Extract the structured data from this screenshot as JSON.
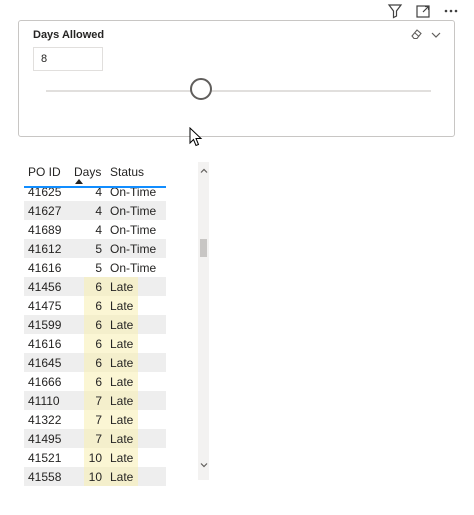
{
  "slicer": {
    "title": "Days Allowed",
    "value": "8",
    "slider_value": 8
  },
  "table": {
    "columns": [
      "PO ID",
      "Days",
      "Status"
    ],
    "sorted_column": "Days",
    "rows": [
      {
        "po_id": "41625",
        "days": "4",
        "status": "On-Time"
      },
      {
        "po_id": "41627",
        "days": "4",
        "status": "On-Time"
      },
      {
        "po_id": "41689",
        "days": "4",
        "status": "On-Time"
      },
      {
        "po_id": "41612",
        "days": "5",
        "status": "On-Time"
      },
      {
        "po_id": "41616",
        "days": "5",
        "status": "On-Time"
      },
      {
        "po_id": "41456",
        "days": "6",
        "status": "Late"
      },
      {
        "po_id": "41475",
        "days": "6",
        "status": "Late"
      },
      {
        "po_id": "41599",
        "days": "6",
        "status": "Late"
      },
      {
        "po_id": "41616",
        "days": "6",
        "status": "Late"
      },
      {
        "po_id": "41645",
        "days": "6",
        "status": "Late"
      },
      {
        "po_id": "41666",
        "days": "6",
        "status": "Late"
      },
      {
        "po_id": "41110",
        "days": "7",
        "status": "Late"
      },
      {
        "po_id": "41322",
        "days": "7",
        "status": "Late"
      },
      {
        "po_id": "41495",
        "days": "7",
        "status": "Late"
      },
      {
        "po_id": "41521",
        "days": "10",
        "status": "Late"
      },
      {
        "po_id": "41558",
        "days": "10",
        "status": "Late"
      }
    ]
  },
  "colors": {
    "late_highlight": "#fbf6d4",
    "accent": "#118dff"
  }
}
